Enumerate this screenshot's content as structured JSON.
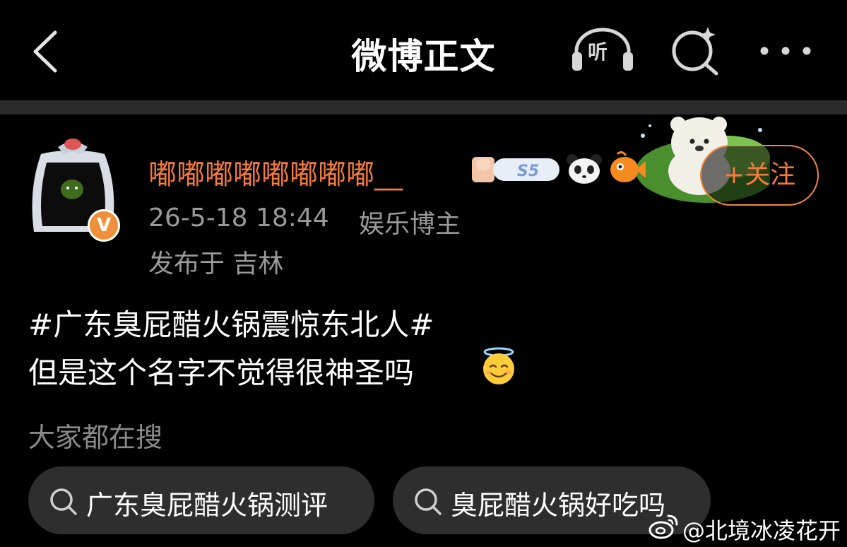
{
  "nav": {
    "title": "微博正文",
    "listen_icon_text": "听",
    "icons": [
      "back-chevron-icon",
      "listen-headphones-icon",
      "search-sparkle-icon",
      "more-dots-icon"
    ]
  },
  "post": {
    "author": "嘟嘟嘟嘟嘟嘟嘟嘟__",
    "verified_badge": "V",
    "level_badge": "S5",
    "follow_label": "+关注",
    "timestamp": "26-5-18 18:44",
    "role": "娱乐博主",
    "location": "发布于 吉林",
    "content_line1": "#广东臭屁醋火锅震惊东北人#",
    "content_line2": "但是这个名字不觉得很神圣吗"
  },
  "hot_search": {
    "label": "大家都在搜",
    "items": [
      {
        "label": "广东臭屁醋火锅测评"
      },
      {
        "label": "臭屁醋火锅好吃吗"
      }
    ]
  },
  "watermark": {
    "text": "@北境冰凌花开"
  },
  "colors": {
    "background": "#000000",
    "accent": "#f47b3f",
    "secondary_text": "#9a9a9a",
    "pill_bg": "#2e2e2e",
    "divider": "#2b2b2b"
  }
}
